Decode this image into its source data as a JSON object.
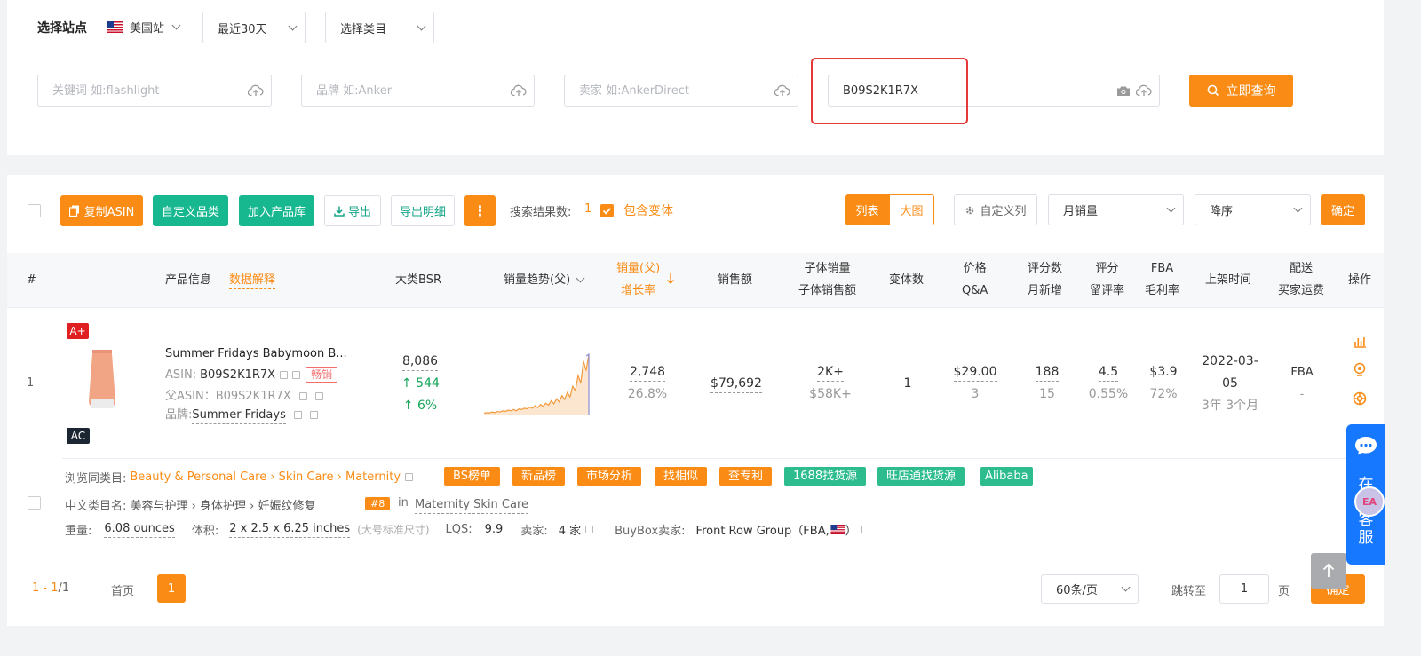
{
  "filters": {
    "site_label": "选择站点",
    "site_value": "美国站",
    "period": "最近30天",
    "category": "选择类目",
    "keyword_placeholder": "关键词 如:flashlight",
    "brand_placeholder": "品牌 如:Anker",
    "seller_placeholder": "卖家 如:AnkerDirect",
    "asin_value": "B09S2K1R7X",
    "query_button": "立即查询"
  },
  "toolbar": {
    "copy_asin": "复制ASIN",
    "custom_category": "自定义品类",
    "add_library": "加入产品库",
    "export": "导出",
    "export_detail": "导出明细",
    "more": "⋮",
    "result_label": "搜索结果数:",
    "result_count": "1",
    "include_variants": "包含变体",
    "view_list": "列表",
    "view_large": "大图",
    "custom_columns": "自定义列",
    "sort_field": "月销量",
    "sort_order": "降序",
    "confirm": "确定"
  },
  "table": {
    "headers": {
      "index": "#",
      "product": "产品信息",
      "data_explain": "数据解释",
      "bsr": "大类BSR",
      "trend": "销量趋势(父)",
      "sales_1": "销量(父)",
      "sales_2": "增长率",
      "revenue": "销售额",
      "child_1": "子体销量",
      "child_2": "子体销售额",
      "variants": "变体数",
      "price_1": "价格",
      "price_2": "Q&A",
      "rating_1": "评分数",
      "rating_2": "月新增",
      "score_1": "评分",
      "score_2": "留评率",
      "fba_1": "FBA",
      "fba_2": "毛利率",
      "listed": "上架时间",
      "ship_1": "配送",
      "ship_2": "买家运费",
      "actions": "操作"
    },
    "row": {
      "index": "1",
      "badge_aplus": "A+",
      "badge_ac": "AC",
      "title": "Summer Fridays Babymoon B...",
      "asin_label": "ASIN:",
      "asin": "B09S2K1R7X",
      "hot_tag": "畅销",
      "parent_asin": "父ASIN：B09S2K1R7X",
      "brand_label": "品牌:",
      "brand": "Summer Fridays",
      "bsr": "8,086",
      "bsr_change": "↑ 544",
      "bsr_pct": "↑ 6%",
      "sales": "2,748",
      "growth": "26.8%",
      "revenue": "$79,692",
      "child_sales": "2K+",
      "child_revenue": "$58K+",
      "variants": "1",
      "price": "$29.00",
      "qa": "3",
      "ratings": "188",
      "ratings_new": "15",
      "score": "4.5",
      "review_rate": "0.55%",
      "fba": "$3.9",
      "margin": "72%",
      "listed_date": "2022-03-",
      "listed_date2": "05",
      "listed_age": "3年 3个月",
      "ship": "FBA",
      "ship_fee": "-"
    },
    "trend_series": [
      2,
      3,
      2.5,
      4,
      3,
      5,
      4,
      6,
      5,
      7,
      6,
      8,
      6,
      9,
      8,
      10,
      9,
      12,
      10,
      14,
      11,
      16,
      13,
      18,
      15,
      22,
      17,
      25,
      20,
      30,
      24,
      35,
      28,
      45,
      38,
      62,
      50,
      85,
      70,
      96
    ]
  },
  "detail": {
    "browse_label": "浏览同类目:",
    "browse_path": "Beauty & Personal Care › Skin Care › Maternity",
    "tags": [
      "BS榜单",
      "新品榜",
      "市场分析",
      "找相似",
      "查专利",
      "1688找货源",
      "旺店通找货源",
      "Alibaba"
    ],
    "cn_label": "中文类目名:",
    "cn_path": "美容与护理 › 身体护理 › 妊娠纹修复",
    "rank": "#8",
    "rank_in": "in",
    "rank_cat": "Maternity Skin Care",
    "weight_label": "重量:",
    "weight": "6.08 ounces",
    "size_label": "体积:",
    "size": "2 x 2.5 x 6.25 inches",
    "size_note": "(大号标准尺寸)",
    "lqs_label": "LQS:",
    "lqs": "9.9",
    "sellers_label": "卖家:",
    "sellers": "4 家",
    "buybox_label": "BuyBox卖家:",
    "buybox": "Front Row Group（FBA,",
    "buybox_end": "）"
  },
  "pagination": {
    "range": "1 - 1",
    "total": "/1",
    "first": "首页",
    "page": "1",
    "per_page": "60条/页",
    "jump_label": "跳转至",
    "jump_value": "1",
    "page_unit": "页",
    "confirm": "确定"
  },
  "service": {
    "label_1": "在线",
    "label_2": "客服",
    "avatar": "EA"
  },
  "colors": {
    "accent": "#fa8c16",
    "green": "#17b890",
    "red_box": "#e53935"
  }
}
